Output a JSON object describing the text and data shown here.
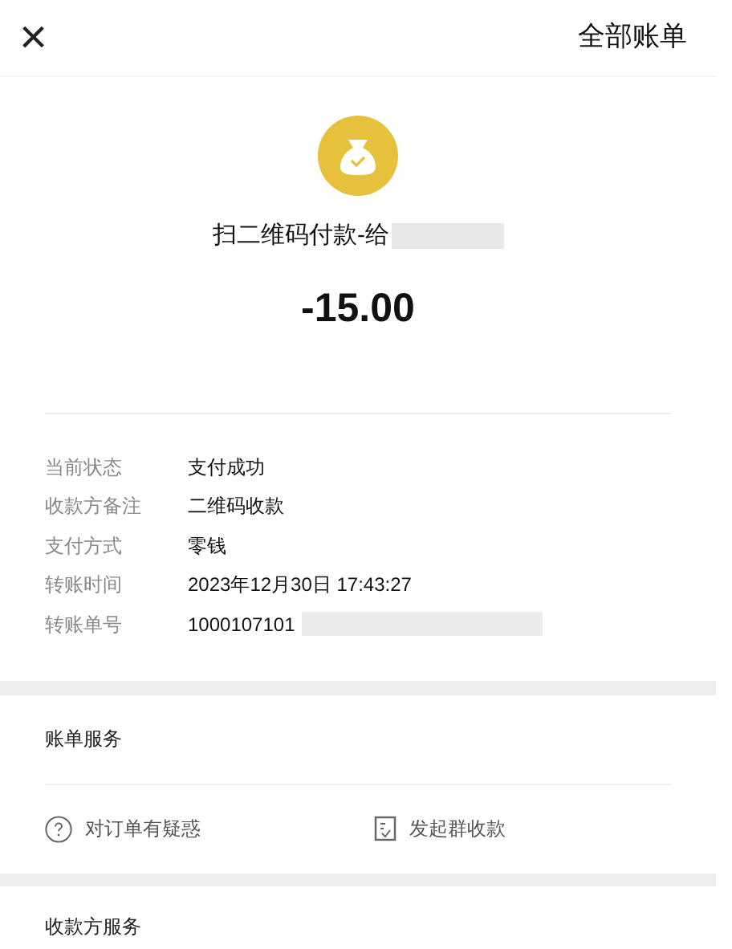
{
  "header": {
    "close": "×",
    "all_bills": "全部账单"
  },
  "payment": {
    "title": "扫二维码付款-给",
    "amount": "-15.00"
  },
  "details": [
    {
      "label": "当前状态",
      "value": "支付成功",
      "redacted": false
    },
    {
      "label": "收款方备注",
      "value": "二维码收款",
      "redacted": false
    },
    {
      "label": "支付方式",
      "value": "零钱",
      "redacted": false
    },
    {
      "label": "转账时间",
      "value": "2023年12月30日 17:43:27",
      "redacted": false
    },
    {
      "label": "转账单号",
      "value": "1000107101",
      "redacted": true
    }
  ],
  "bill_services": {
    "title": "账单服务",
    "actions": [
      {
        "kind": "question",
        "label": "对订单有疑惑"
      },
      {
        "kind": "document",
        "label": "发起群收款"
      }
    ]
  },
  "payee_services": {
    "title": "收款方服务"
  }
}
